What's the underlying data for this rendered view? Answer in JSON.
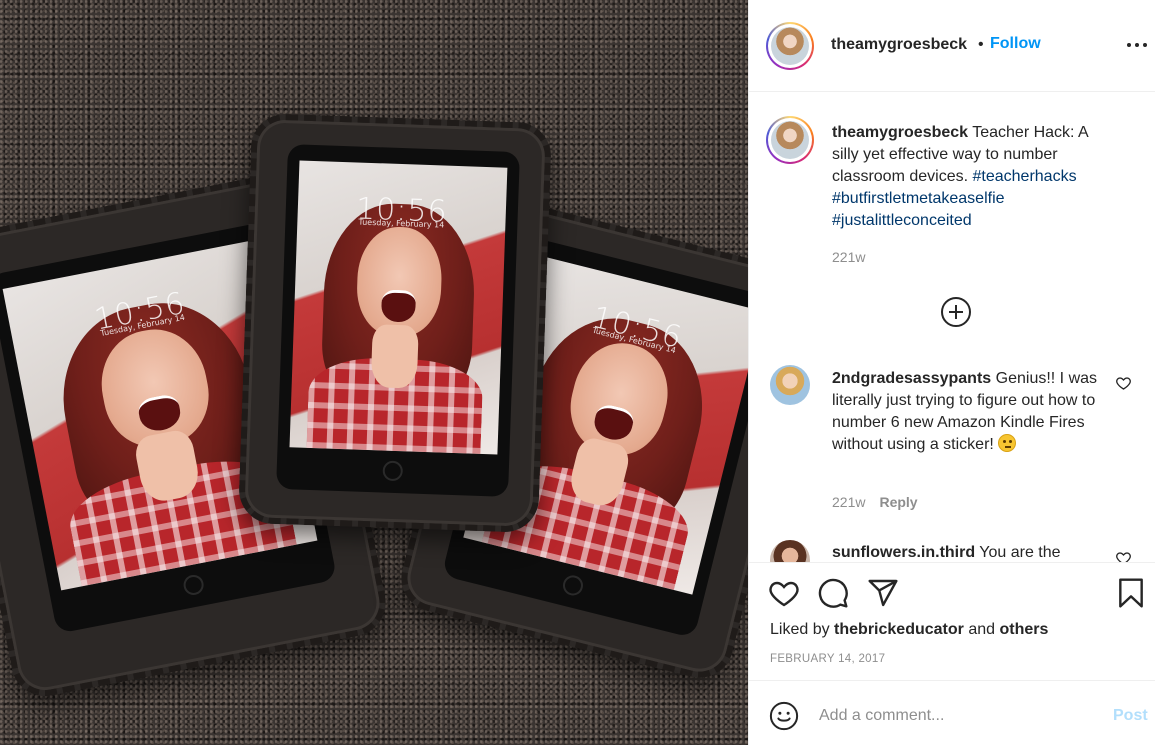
{
  "post": {
    "username": "theamygroesbeck",
    "separator": "•",
    "follow_label": "Follow",
    "more_icon": "more-horizontal-icon"
  },
  "photo": {
    "tablets": [
      {
        "time": "10:56",
        "date": "Tuesday, February 14"
      },
      {
        "time": "10:56",
        "date": "Tuesday, February 14"
      },
      {
        "time": "10:56",
        "date": "Tuesday, February 14"
      }
    ]
  },
  "caption": {
    "username": "theamygroesbeck",
    "text": "Teacher Hack: A silly yet effective way to number classroom devices.",
    "hashtags": [
      "#teacherhacks",
      "#butfirstletmetakeaselfie",
      "#justalittleconceited"
    ],
    "age": "221w"
  },
  "load_more_icon": "plus-circle-icon",
  "comments": [
    {
      "username": "2ndgradesassypants",
      "text": "Genius!! I was literally just trying to figure out how to number 6 new Amazon Kindle Fires without using a sticker!",
      "emoji": "smirking-face-emoji",
      "age": "221w",
      "reply_label": "Reply"
    },
    {
      "username": "sunflowers.in.third",
      "text": "You are the"
    }
  ],
  "actions": {
    "icons": [
      "heart-icon",
      "comment-icon",
      "share-icon",
      "bookmark-icon"
    ],
    "liked_prefix": "Liked by",
    "liked_user": "thebrickeducator",
    "liked_and": "and",
    "liked_others": "others",
    "date": "FEBRUARY 14, 2017"
  },
  "add_comment": {
    "placeholder": "Add a comment...",
    "post_label": "Post"
  },
  "colors": {
    "link_blue": "#0095f6",
    "hashtag": "#00376b",
    "muted": "#8e8e8e",
    "post_disabled": "#b2dffc"
  }
}
